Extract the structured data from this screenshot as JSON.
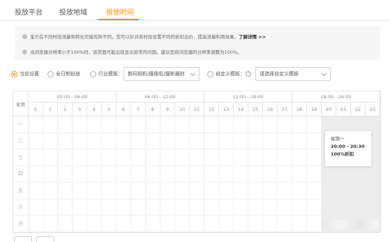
{
  "tabs": [
    {
      "label": "投放平台"
    },
    {
      "label": "投放地域"
    },
    {
      "label": "投放时间"
    }
  ],
  "active_tab": 2,
  "accent_color": "#ff8a00",
  "notice": {
    "line1_text": "宝贝在不同时段流量和转化可能有所不同，您可以针对各时段设置不同的折扣出价，提高流量利用效果，",
    "line1_link": "了解详情 >>",
    "line2_text": "当浏览器分辨率小于100%时，该页面可能出现显示异常的问题。建议您将浏览器的分辨率调整为100%。"
  },
  "options": {
    "current": "当前设置",
    "allday": "全日制投放",
    "industry": "行业模板：",
    "industry_select": "数码相机/摄像机/摄影器材",
    "custom": "自定义模板：",
    "custom_select_placeholder": "请选择自定义模板"
  },
  "grid": {
    "day_header": "星期",
    "groups": [
      "00:00 - 06:00",
      "06:00 - 12:00",
      "12:00 - 18:00",
      "18:00 - 24:00"
    ],
    "hours": [
      "0",
      "1",
      "2",
      "3",
      "4",
      "5",
      "6",
      "7",
      "8",
      "9",
      "10",
      "11",
      "12",
      "13",
      "14",
      "15",
      "16",
      "17",
      "18",
      "19",
      "20",
      "21",
      "22",
      "23"
    ],
    "days": [
      "一",
      "二",
      "三",
      "四",
      "五",
      "六",
      "日"
    ],
    "selected_hours_from": 20,
    "selected_hours_to": 23
  },
  "tooltip": {
    "day": "星期一",
    "time": "20:00 - 20:30",
    "discount": "100%折扣"
  }
}
